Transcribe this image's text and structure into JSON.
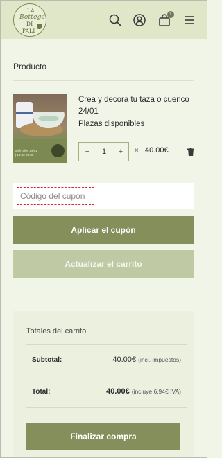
{
  "header": {
    "logo": {
      "line1": "LA",
      "line2": "Bottega",
      "line3": "DI",
      "line4": "PALI"
    },
    "icons": [
      "search-icon",
      "user-icon",
      "cart-icon",
      "menu-icon"
    ],
    "cart_count": "1"
  },
  "cart": {
    "section_title": "Producto",
    "product": {
      "name": "Crea y decora tu taza o cuenco 24/01",
      "stock": "Plazas disponibles",
      "quantity": "1",
      "minus": "−",
      "plus": "+",
      "times": "×",
      "price": "40.00€",
      "image_caption_line1": "Miércoles 24/01",
      "image_caption_line2": "| 18:00-20:30"
    },
    "coupon": {
      "placeholder": "Código del cupón"
    },
    "apply_label": "Aplicar el cupón",
    "update_label": "Actualizar el carrito"
  },
  "totals": {
    "title": "Totales del carrito",
    "subtotal_label": "Subtotal:",
    "subtotal_amount": "40.00€",
    "subtotal_note": "(incl. impuestos)",
    "total_label": "Total:",
    "total_amount": "40.00€",
    "total_note": "(incluye 6.94€ IVA)",
    "checkout_label": "Finalizar compra"
  },
  "colors": {
    "accent": "#848f5c",
    "accent_light": "#bfcaa5",
    "header_bg": "#dfe7c8",
    "page_bg": "#f1f5e8",
    "coupon_border": "#d1283a"
  }
}
